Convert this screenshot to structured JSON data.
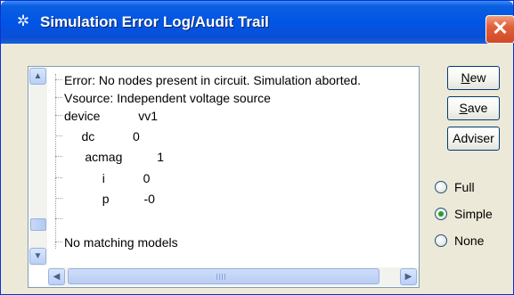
{
  "window": {
    "title": "Simulation Error Log/Audit Trail",
    "title_icon": "sim-tool-icon",
    "close_symbol": "✕"
  },
  "log": {
    "lines": [
      "Error: No nodes present in circuit. Simulation aborted.",
      "Vsource: Independent voltage source",
      "device           vv1",
      "     dc           0",
      "      acmag          1",
      "           i           0",
      "           p          -0",
      "",
      "No matching models"
    ]
  },
  "scrollbar": {
    "up_symbol": "▲",
    "down_symbol": "▼",
    "left_symbol": "◀",
    "right_symbol": "▶"
  },
  "buttons": {
    "new": "New",
    "save": "Save",
    "adviser": "Adviser"
  },
  "mode_options": [
    {
      "label": "Full",
      "selected": false
    },
    {
      "label": "Simple",
      "selected": true
    },
    {
      "label": "None",
      "selected": false
    }
  ],
  "colors": {
    "titlebar": "#0055e5",
    "close_button": "#d24a25",
    "radio_selected": "#21a121"
  }
}
